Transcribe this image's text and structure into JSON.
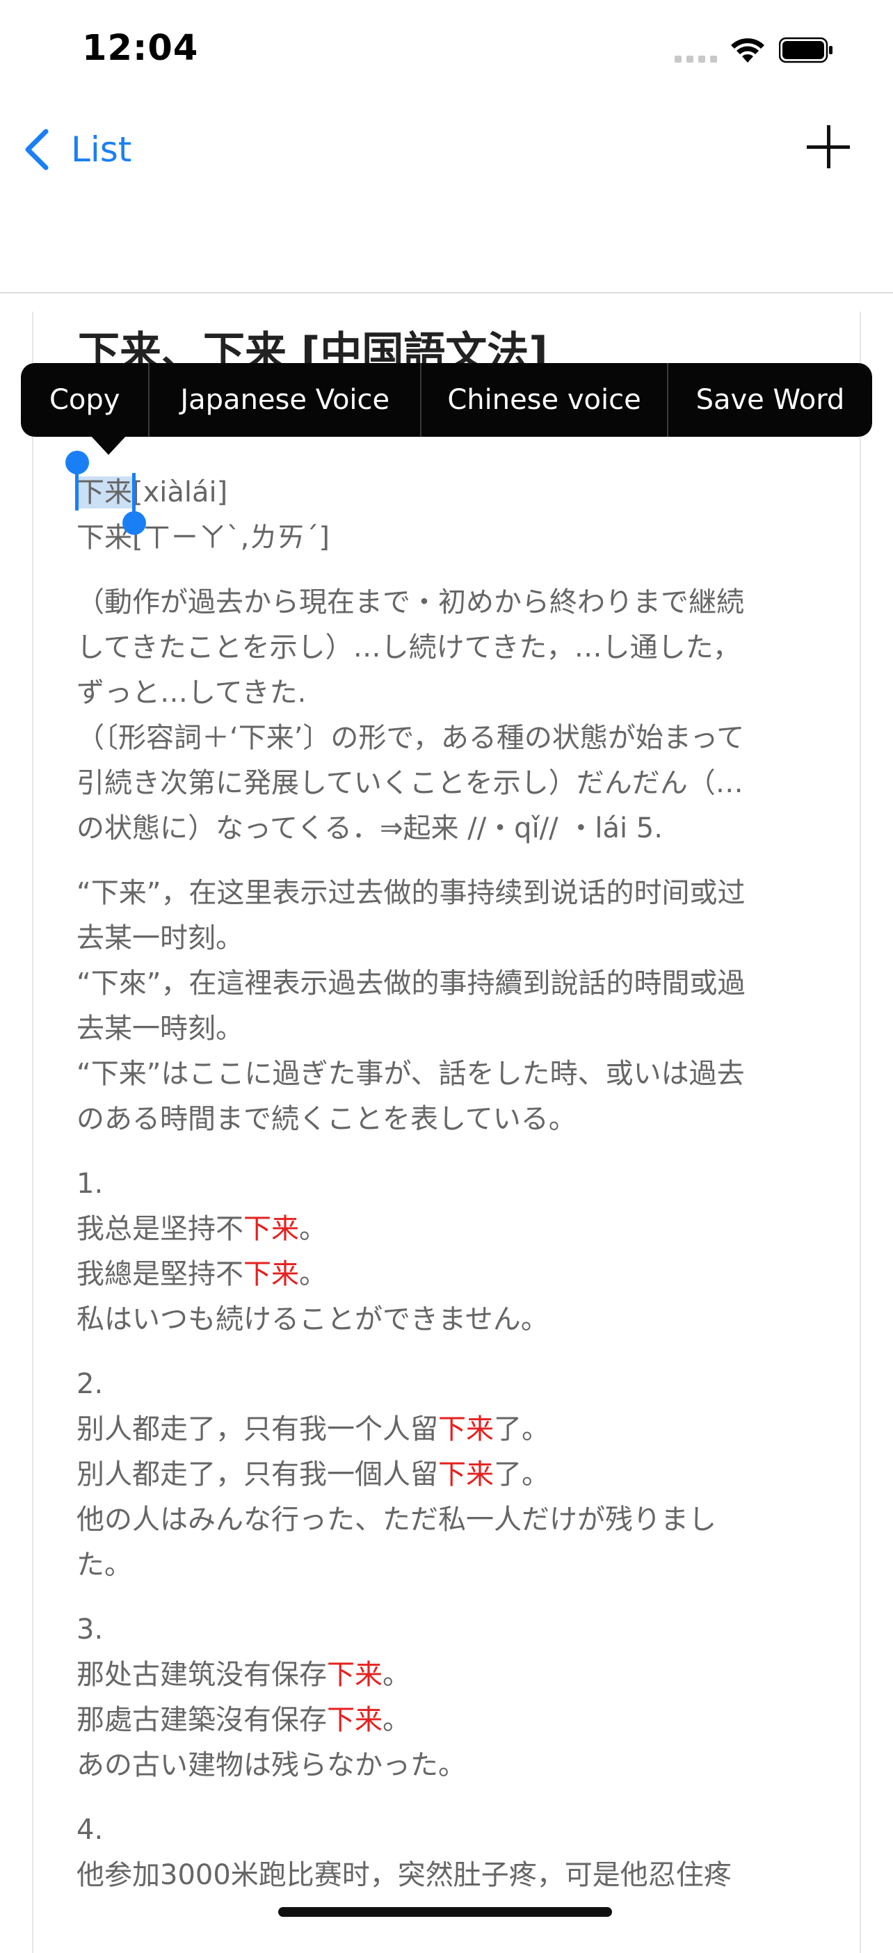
{
  "status_bar": {
    "time": "12:04"
  },
  "nav": {
    "back_label": "List"
  },
  "entry": {
    "title": "下来、下来 [中国語文法]"
  },
  "context_menu": {
    "items": [
      {
        "label": "Copy"
      },
      {
        "label": "Japanese Voice"
      },
      {
        "label": "Chinese voice"
      },
      {
        "label": "Save Word"
      }
    ]
  },
  "pinyin": {
    "selected_word": "下来",
    "pinyin": "[xiàlái]",
    "zhuyin": "下来[ㄒㄧㄚˋ,ㄌㄞˊ]"
  },
  "definition_ja": [
    "（動作が過去から現在まで・初めから終わりまで継続",
    "してきたことを示し）…し続けてきた，…し通した，",
    "ずっと…してきた.",
    "（〔形容詞＋‘下来’〕の形で，ある種の状態が始まって",
    "引続き次第に発展していくことを示し）だんだん（…",
    "の状態に）なってくる．⇒起来 //・qǐ// ・lái 5."
  ],
  "explanation": [
    "“下来”，在这里表示过去做的事持续到说话的时间或过",
    "去某一时刻。",
    "“下來”，在這裡表示過去做的事持續到說話的時間或過",
    "去某一時刻。",
    "“下来”はここに過ぎた事が、話をした時、或いは過去",
    "のある時間まで続くことを表している。"
  ],
  "examples": [
    {
      "num": "1.",
      "zh_pre": "我总是坚持不",
      "zh_hl": "下来",
      "zh_post": "。",
      "tw_pre": "我總是堅持不",
      "tw_hl": "下来",
      "tw_post": "。",
      "ja": [
        "私はいつも続けることができません。"
      ]
    },
    {
      "num": "2.",
      "zh_pre": "别人都走了，只有我一个人留",
      "zh_hl": "下来",
      "zh_post": "了。",
      "tw_pre": "別人都走了，只有我一個人留",
      "tw_hl": "下来",
      "tw_post": "了。",
      "ja": [
        "他の人はみんな行った、ただ私一人だけが残りまし",
        "た。"
      ]
    },
    {
      "num": "3.",
      "zh_pre": "那处古建筑没有保存",
      "zh_hl": "下来",
      "zh_post": "。",
      "tw_pre": "那處古建築沒有保存",
      "tw_hl": "下来",
      "tw_post": "。",
      "ja": [
        "あの古い建物は残らなかった。"
      ]
    },
    {
      "num": "4.",
      "zh_partial": "他参加3000米跑比赛时，突然肚子疼，可是他忍住疼"
    }
  ]
}
